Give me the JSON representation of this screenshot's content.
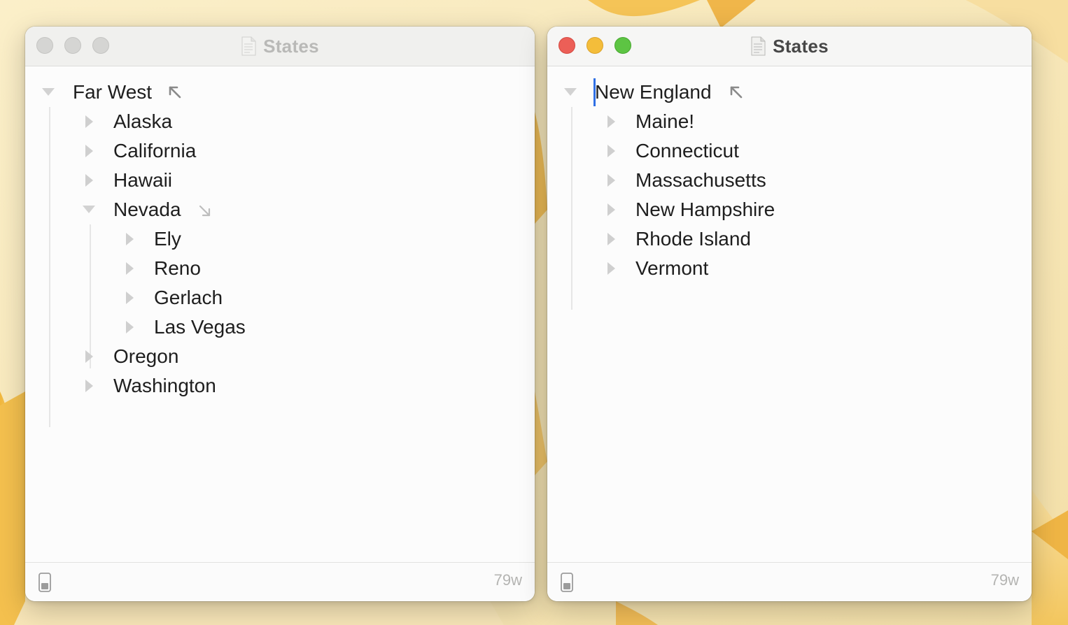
{
  "desktop": {
    "wallpaper": "sonoma-yellow-light"
  },
  "windows": [
    {
      "id": "left",
      "active": false,
      "title": "States",
      "title_icon": "document-icon",
      "root": {
        "label": "Far West",
        "expanded": true,
        "hoist_icon": "hoist-up-icon"
      },
      "items": [
        {
          "label": "Alaska",
          "expanded": false
        },
        {
          "label": "California",
          "expanded": false
        },
        {
          "label": "Hawaii",
          "expanded": false
        },
        {
          "label": "Nevada",
          "expanded": true,
          "focus_icon": "focus-in-icon"
        },
        {
          "label": "Ely",
          "expanded": false
        },
        {
          "label": "Reno",
          "expanded": false
        },
        {
          "label": "Gerlach",
          "expanded": false
        },
        {
          "label": "Las Vegas",
          "expanded": false
        },
        {
          "label": "Oregon",
          "expanded": false
        },
        {
          "label": "Washington",
          "expanded": false
        }
      ],
      "footer": {
        "device_icon": "device-icon",
        "word_count": "79w"
      }
    },
    {
      "id": "right",
      "active": true,
      "title": "States",
      "title_icon": "document-icon",
      "root": {
        "label": "New England",
        "expanded": true,
        "hoist_icon": "hoist-up-icon"
      },
      "items": [
        {
          "label": "Maine!",
          "expanded": false
        },
        {
          "label": "Connecticut",
          "expanded": false
        },
        {
          "label": "Massachusetts",
          "expanded": false
        },
        {
          "label": "New Hampshire",
          "expanded": false
        },
        {
          "label": "Rhode Island",
          "expanded": false
        },
        {
          "label": "Vermont",
          "expanded": false
        }
      ],
      "footer": {
        "device_icon": "device-icon",
        "word_count": "79w"
      }
    }
  ],
  "colors": {
    "close": "#ec5f57",
    "minimize": "#f4bd3a",
    "zoom": "#5dc443",
    "caret": "#2f6fe4"
  }
}
